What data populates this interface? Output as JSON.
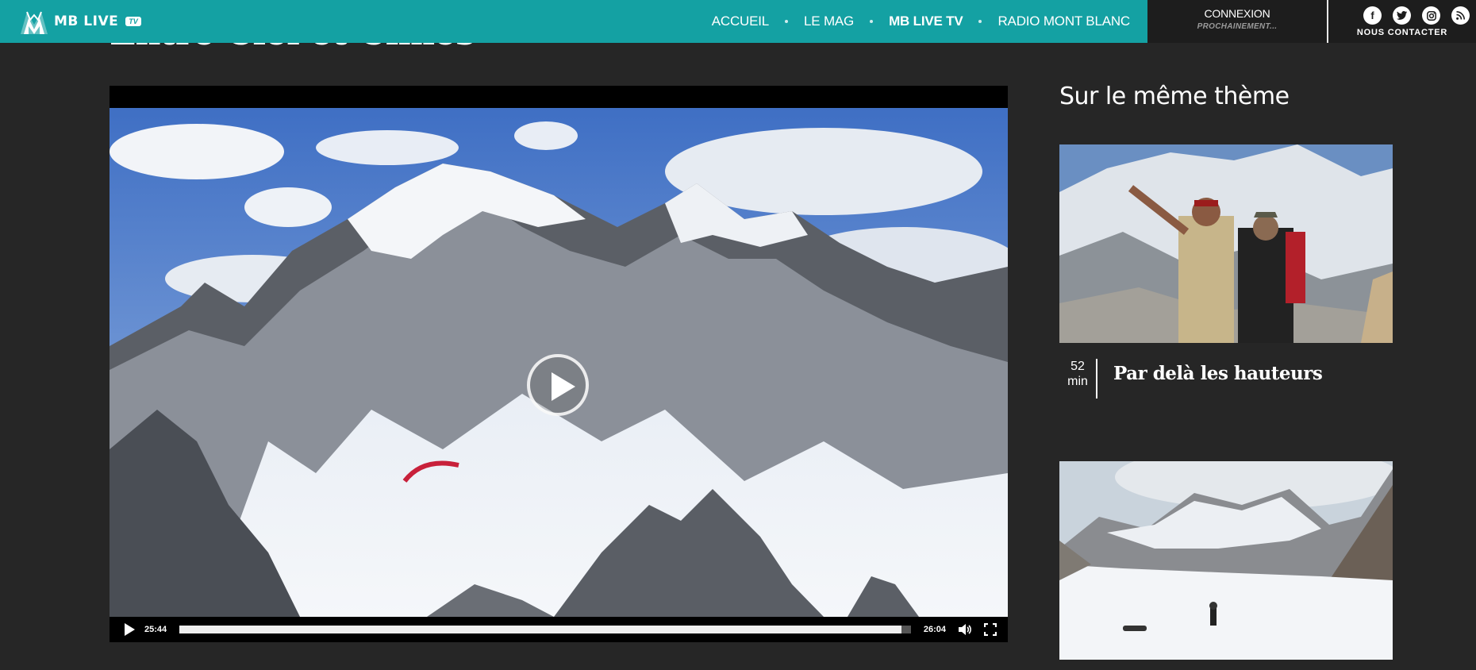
{
  "brand": {
    "name": "MB LIVE",
    "badge": "TV",
    "accent_color": "#14a1a3"
  },
  "nav": {
    "items": [
      {
        "label": "ACCUEIL",
        "active": false
      },
      {
        "label": "LE MAG",
        "active": false
      },
      {
        "label": "MB LIVE TV",
        "active": true
      },
      {
        "label": "RADIO MONT BLANC",
        "active": false
      }
    ]
  },
  "login": {
    "title": "CONNEXION",
    "subtitle": "PROCHAINEMENT..."
  },
  "social": {
    "icons": [
      "facebook-icon",
      "twitter-icon",
      "instagram-icon",
      "rss-icon"
    ],
    "contact_label": "NOUS CONTACTER"
  },
  "page": {
    "title": "Entre Ciel et Cimes"
  },
  "player": {
    "current_time": "25:44",
    "duration": "26:04",
    "progress": 0.987
  },
  "sidebar": {
    "title": "Sur le même thème",
    "cards": [
      {
        "duration_value": "52",
        "duration_unit": "min",
        "title": "Par delà les hauteurs"
      },
      {
        "duration_value": "",
        "duration_unit": "",
        "title": ""
      }
    ]
  }
}
